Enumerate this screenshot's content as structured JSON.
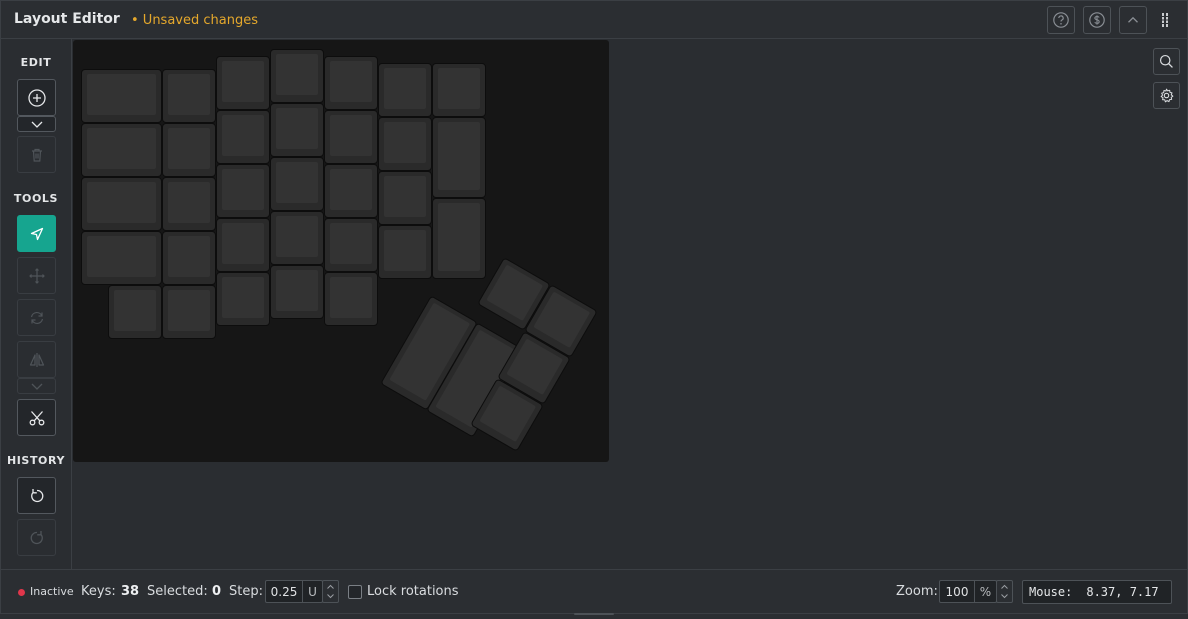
{
  "header": {
    "title": "Layout Editor",
    "unsaved": "• Unsaved changes",
    "buttons": [
      {
        "name": "help-button",
        "icon": "help-circle-icon"
      },
      {
        "name": "donate-button",
        "icon": "dollar-circle-icon"
      },
      {
        "name": "collapse-button",
        "icon": "chevron-up-icon"
      }
    ]
  },
  "sidebar": {
    "edit_label": "EDIT",
    "tools_label": "TOOLS",
    "history_label": "HISTORY",
    "edit_buttons": [
      {
        "name": "add-key-button",
        "icon": "plus-circle-icon",
        "enabled": true
      },
      {
        "name": "add-options-dropdown",
        "icon": "chevron-down-icon",
        "enabled": true
      },
      {
        "name": "delete-button",
        "icon": "trash-icon",
        "enabled": false
      }
    ],
    "tool_buttons": [
      {
        "name": "select-tool",
        "icon": "cursor-arrow-icon",
        "active": true
      },
      {
        "name": "move-tool",
        "icon": "move-arrows-icon",
        "enabled": false
      },
      {
        "name": "rotate-tool",
        "icon": "rotate-icon",
        "enabled": false
      },
      {
        "name": "mirror-tool",
        "icon": "mirror-icon",
        "enabled": false
      },
      {
        "name": "mirror-options-dropdown",
        "icon": "chevron-down-icon",
        "enabled": false
      },
      {
        "name": "cut-tool",
        "icon": "scissors-icon",
        "enabled": true
      }
    ],
    "history_buttons": [
      {
        "name": "undo-button",
        "icon": "undo-icon",
        "enabled": true
      },
      {
        "name": "redo-button",
        "icon": "redo-icon",
        "enabled": false
      }
    ]
  },
  "canvas": {
    "key_count_drawn": 38,
    "buttons": [
      {
        "name": "search-button",
        "icon": "search-icon"
      },
      {
        "name": "settings-button",
        "icon": "gear-icon"
      }
    ]
  },
  "footer": {
    "status": "Inactive",
    "status_color": "#e0364b",
    "keys_label": "Keys:",
    "keys_value": "38",
    "selected_label": "Selected:",
    "selected_value": "0",
    "step_label": "Step:",
    "step_value": "0.25",
    "step_unit": "U",
    "lock_label": "Lock rotations",
    "lock_checked": false,
    "zoom_label": "Zoom:",
    "zoom_value": "100",
    "zoom_unit": "%",
    "mouse_label": "Mouse:",
    "mouse_value": "8.37, 7.17"
  },
  "colors": {
    "accent": "#16a58f",
    "warning": "#e5a82c",
    "background": "#2a2d31",
    "board": "#161616"
  }
}
